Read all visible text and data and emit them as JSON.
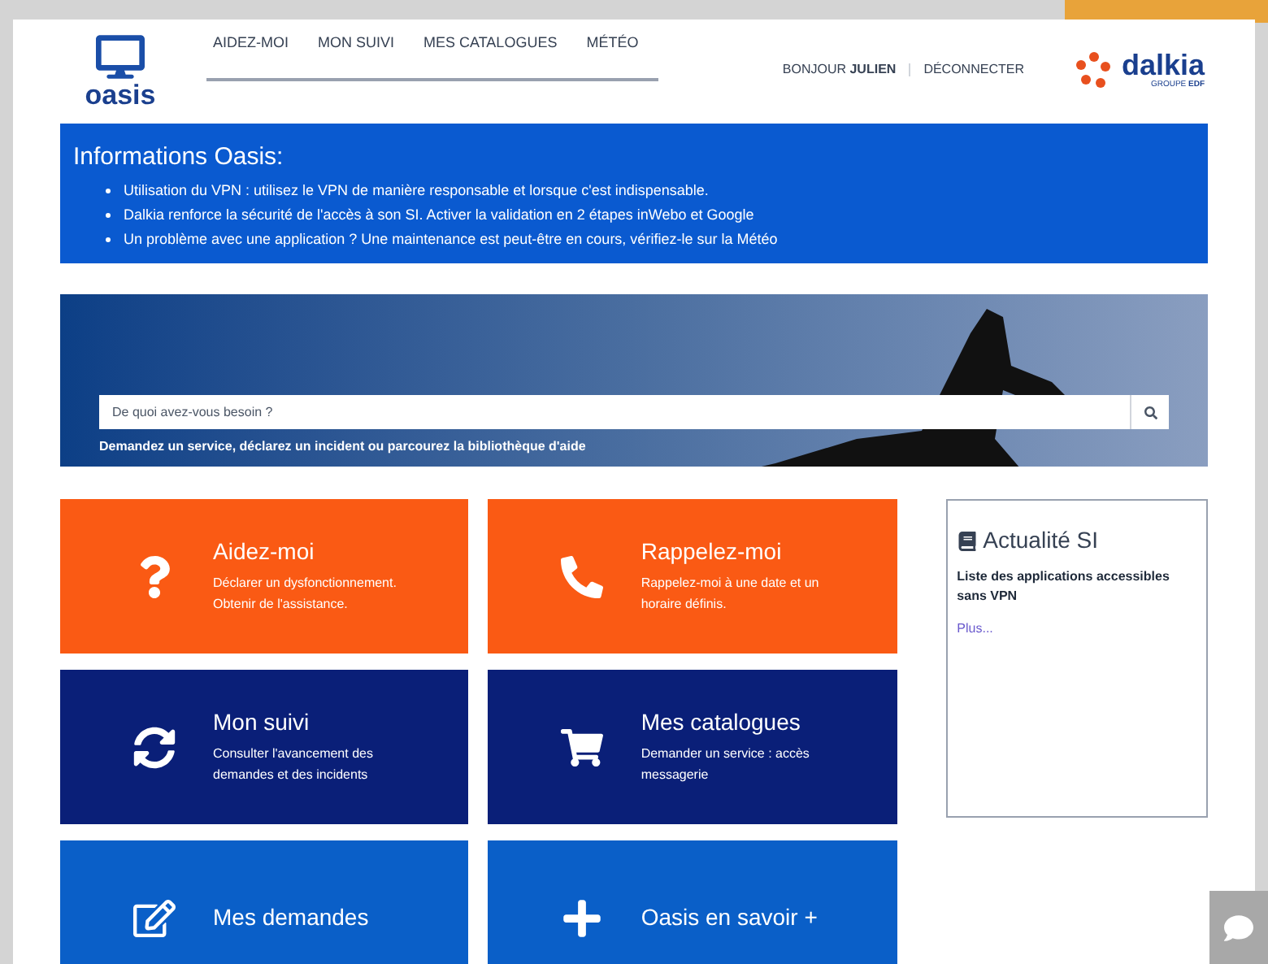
{
  "header": {
    "logo_text": "oasis",
    "nav": [
      {
        "label": "AIDEZ-MOI"
      },
      {
        "label": "MON SUIVI"
      },
      {
        "label": "MES CATALOGUES"
      },
      {
        "label": "MÉTÉO"
      }
    ],
    "greeting": "BONJOUR **JULIEN**",
    "logout": "DÉCONNECTER",
    "brand": "dalkia",
    "brand_sub": "GROUPE **EDF**"
  },
  "info": {
    "title": "Informations Oasis:",
    "items": [
      "Utilisation du VPN : utilisez le VPN de manière responsable et lorsque c'est indispensable.",
      "Dalkia renforce la sécurité de l'accès à son SI. Activer la validation en 2 étapes inWebo et Google",
      "Un problème avec une application ? Une maintenance est peut-être en cours, vérifiez-le sur la Météo"
    ]
  },
  "search": {
    "placeholder": "De quoi avez-vous besoin ?",
    "hint": "Demandez un service, déclarez un incident ou parcourez la bibliothèque d'aide"
  },
  "tiles": [
    {
      "kind": "help",
      "title": "Aidez-moi",
      "text": "Déclarer un dysfonctionnement. Obtenir de l'assistance.",
      "color": "#fa5a14"
    },
    {
      "kind": "phone",
      "title": "Rappelez-moi",
      "text": "Rappelez-moi à une date et un horaire définis.",
      "color": "#fa5a14"
    },
    {
      "kind": "sync",
      "title": "Mon suivi",
      "text": "Consulter l'avancement des demandes et des incidents",
      "color": "#0a1f78"
    },
    {
      "kind": "cart",
      "title": "Mes catalogues",
      "text": "Demander un service : accès messagerie",
      "color": "#0a1f78"
    },
    {
      "kind": "edit",
      "title": "Mes demandes",
      "color": "#0a5fc8"
    },
    {
      "kind": "plus",
      "title": "Oasis en savoir +",
      "color": "#0a5fc8"
    }
  ],
  "news": {
    "title": "Actualité SI",
    "item": "Liste des applications accessibles sans VPN",
    "more": "Plus..."
  }
}
